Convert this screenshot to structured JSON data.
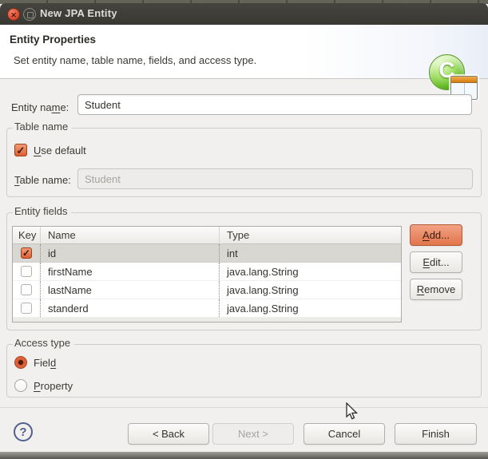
{
  "colors": {
    "titlebar_bg": "#3c3b36",
    "close_button": "#d84a2f",
    "accent_orange": "#dd5f33",
    "add_button_bg": "#ec9271",
    "selected_row_bg": "#d8d7d2",
    "dialog_bg": "#f1f0ee",
    "banner_bg": "#ffffff",
    "help_icon_color": "#50608e"
  },
  "window": {
    "title": "New JPA Entity",
    "close_glyph": "✕"
  },
  "banner": {
    "title": "Entity Properties",
    "subtitle": "Set entity name, table name, fields, and access type.",
    "icon_letter": "C"
  },
  "entity_name": {
    "label": {
      "pre": "Entity na",
      "mn": "m",
      "post": "e:"
    },
    "value": "Student"
  },
  "table_name_group": {
    "legend": "Table name",
    "use_default": {
      "label": {
        "pre": "",
        "mn": "U",
        "post": "se default"
      },
      "checked": true
    },
    "table_name": {
      "label": {
        "pre": "",
        "mn": "T",
        "post": "able name:"
      },
      "value": "Student",
      "disabled": true
    }
  },
  "fields_group": {
    "legend": "Entity fields",
    "columns": [
      "Key",
      "Name",
      "Type"
    ],
    "rows": [
      {
        "key": true,
        "name": "id",
        "type": "int",
        "selected": true
      },
      {
        "key": false,
        "name": "firstName",
        "type": "java.lang.String",
        "selected": false
      },
      {
        "key": false,
        "name": "lastName",
        "type": "java.lang.String",
        "selected": false
      },
      {
        "key": false,
        "name": "standerd",
        "type": "java.lang.String",
        "selected": false
      }
    ],
    "buttons": [
      {
        "label": {
          "pre": "",
          "mn": "A",
          "post": "dd..."
        },
        "accent": true
      },
      {
        "label": {
          "pre": "",
          "mn": "E",
          "post": "dit..."
        },
        "accent": false
      },
      {
        "label": {
          "pre": "",
          "mn": "R",
          "post": "emove"
        },
        "accent": false
      }
    ]
  },
  "access_group": {
    "legend": "Access type",
    "options": [
      {
        "label": {
          "pre": "Fiel",
          "mn": "d",
          "post": ""
        },
        "selected": true
      },
      {
        "label": {
          "pre": "",
          "mn": "P",
          "post": "roperty"
        },
        "selected": false
      }
    ]
  },
  "footer": {
    "help_glyph": "?",
    "back_label": "< Back",
    "next_label": "Next >",
    "next_disabled": true,
    "cancel_label": "Cancel",
    "finish_label": "Finish"
  }
}
